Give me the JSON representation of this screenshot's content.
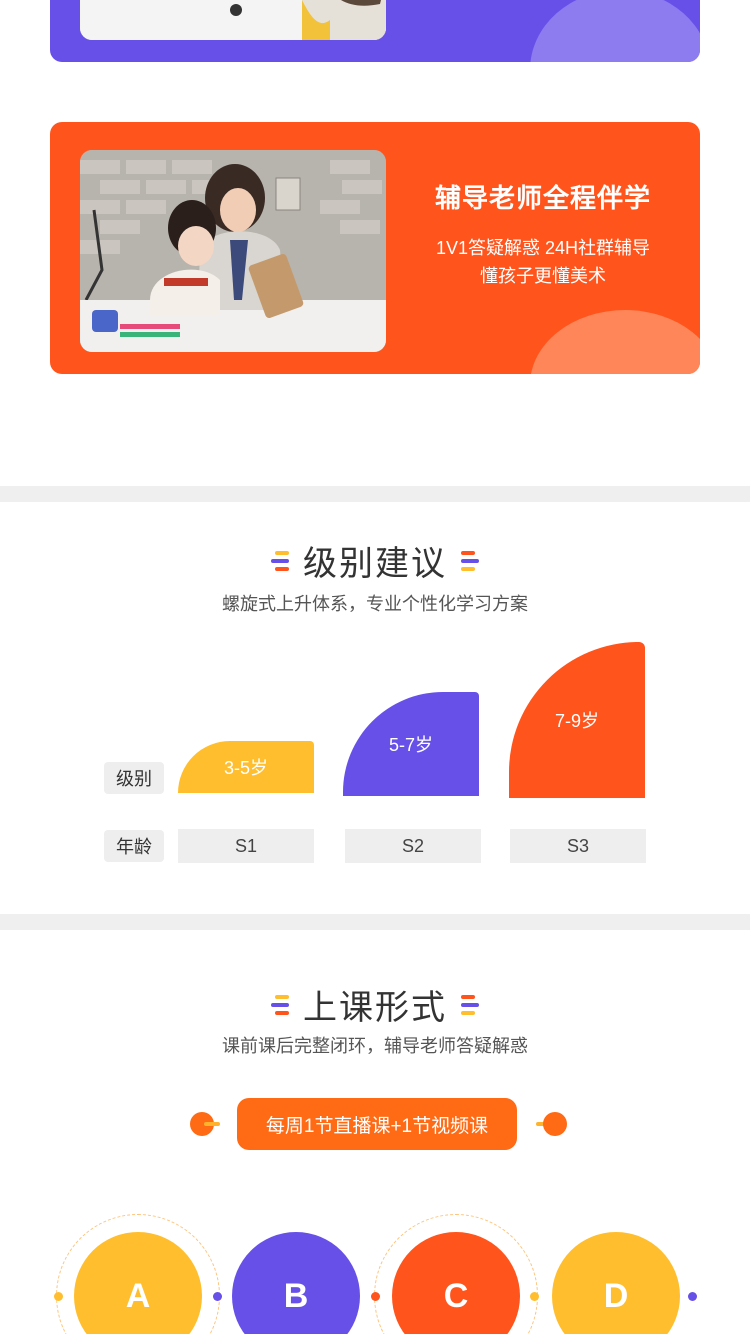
{
  "cards": [
    {
      "id": "purple",
      "color": "#6650e8",
      "title": "",
      "lines": []
    },
    {
      "id": "orange",
      "color": "#ff541c",
      "title": "辅导老师全程伴学",
      "lines": [
        "1V1答疑解惑 24H社群辅导",
        "懂孩子更懂美术"
      ]
    }
  ],
  "levels_section": {
    "title": "级别建议",
    "subtitle": "螺旋式上升体系，专业个性化学习方案",
    "row_labels": {
      "top": "级别",
      "bottom": "年龄"
    },
    "columns": [
      {
        "bar_label": "3-5岁",
        "level": "S1",
        "color": "#ffbe2e"
      },
      {
        "bar_label": "5-7岁",
        "level": "S2",
        "color": "#6650e8"
      },
      {
        "bar_label": "7-9岁",
        "level": "S3",
        "color": "#ff541c"
      }
    ]
  },
  "class_section": {
    "title": "上课形式",
    "subtitle": "课前课后完整闭环，辅导老师答疑解惑",
    "pill_label": "每周1节直播课+1节视频课",
    "circles": [
      {
        "letter": "A",
        "color": "#ffbe2e"
      },
      {
        "letter": "B",
        "color": "#6650e8"
      },
      {
        "letter": "C",
        "color": "#ff541c"
      },
      {
        "letter": "D",
        "color": "#ffbe2e"
      }
    ]
  },
  "colors": {
    "orange": "#ff541c",
    "purple": "#6650e8",
    "yellow": "#ffbe2e",
    "divider": "#efefef"
  }
}
